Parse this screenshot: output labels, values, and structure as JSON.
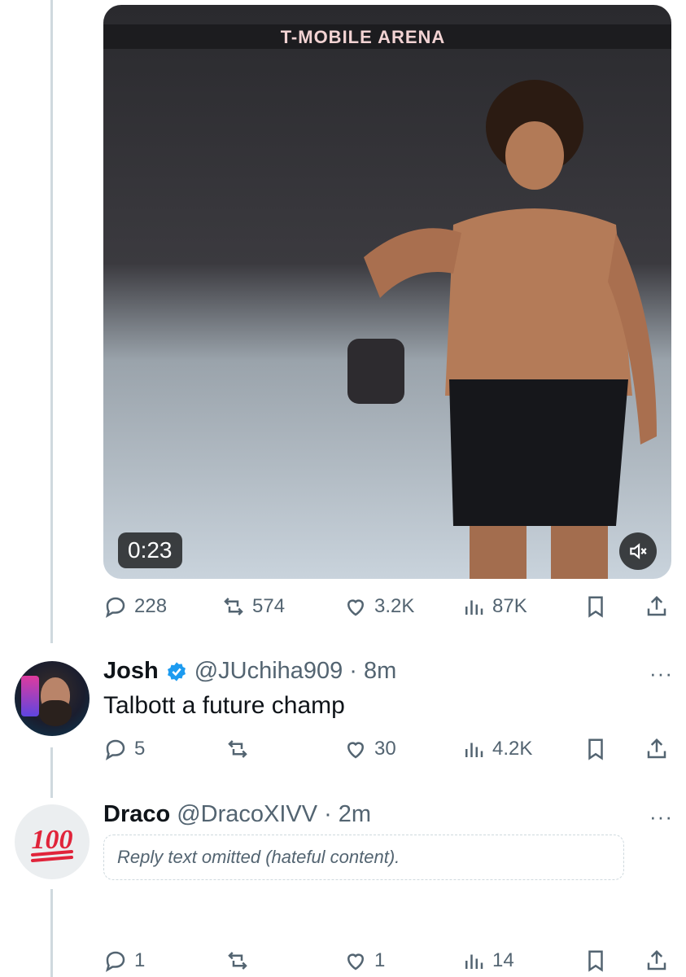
{
  "video": {
    "arena_label": "T-MOBILE ARENA",
    "duration": "0:23"
  },
  "main_actions": {
    "replies": "228",
    "reposts": "574",
    "likes": "3.2K",
    "views": "87K"
  },
  "replies": [
    {
      "name": "Josh",
      "handle": "@JUchiha909",
      "sep": "·",
      "time": "8m",
      "text": "Talbott a future champ",
      "actions": {
        "replies": "5",
        "reposts": "",
        "likes": "30",
        "views": "4.2K"
      }
    },
    {
      "name": "Draco",
      "handle": "@DracoXIVV",
      "sep": "·",
      "time": "2m",
      "placeholder": "Reply text omitted (hateful content).",
      "actions": {
        "replies": "1",
        "reposts": "",
        "likes": "1",
        "views": "14"
      }
    }
  ],
  "more_label": "···",
  "colors": {
    "secondary": "#536471",
    "verified": "#1d9bf0",
    "thread_line": "#cfd9de"
  }
}
